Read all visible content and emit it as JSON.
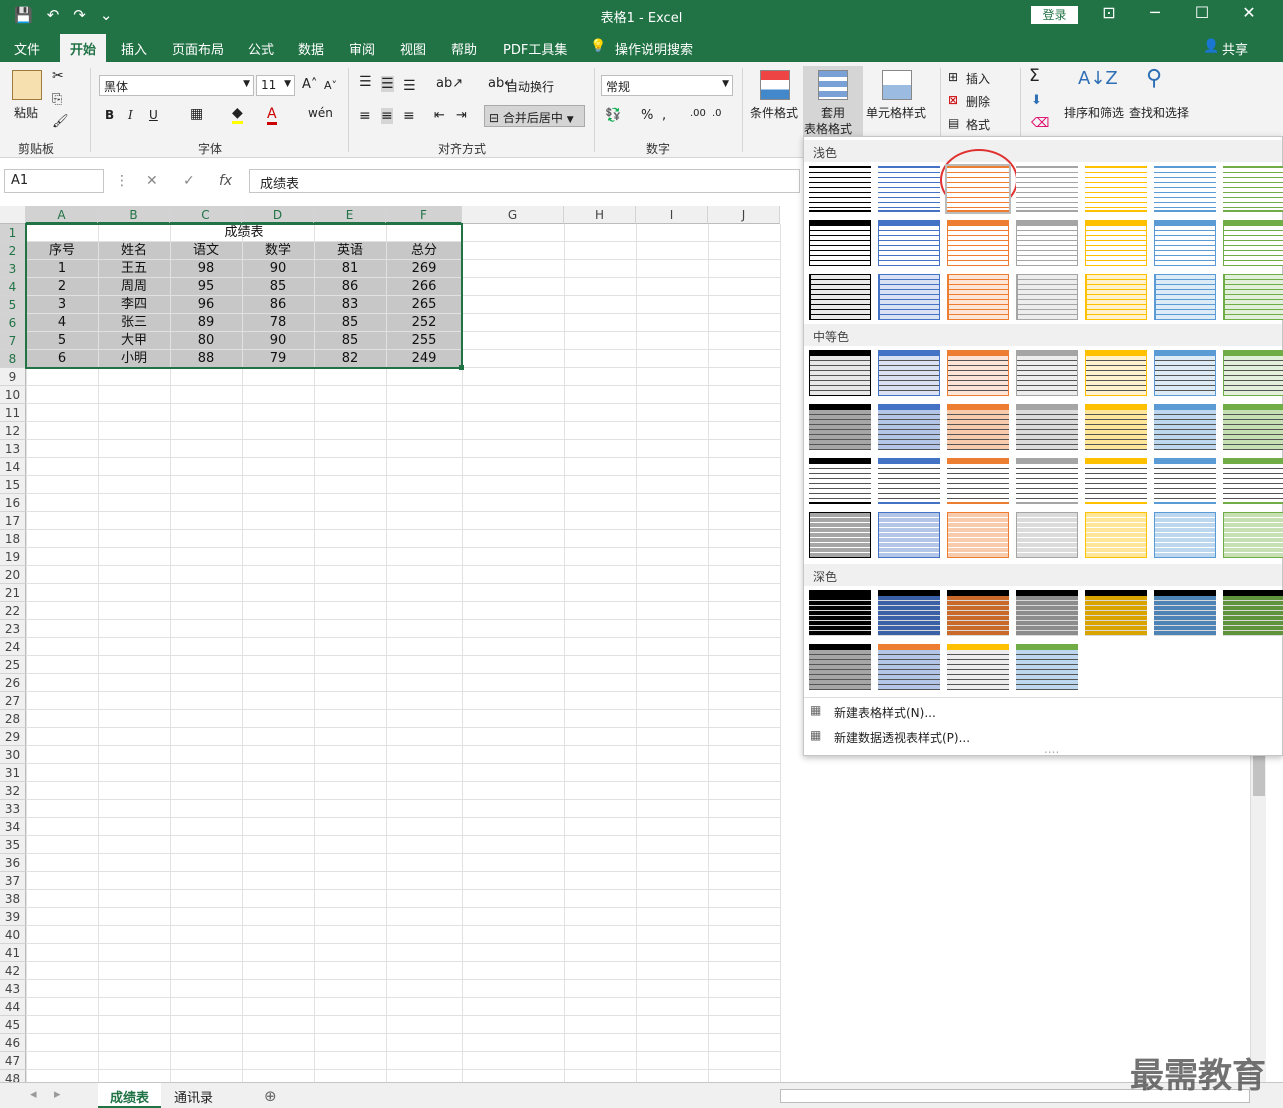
{
  "titlebar": {
    "title": "表格1 - Excel",
    "login": "登录",
    "qat": [
      "💾",
      "↶",
      "↷",
      "⌄"
    ],
    "wc": [
      "⊡",
      "─",
      "☐",
      "✕"
    ]
  },
  "menu": {
    "tabs": [
      "文件",
      "开始",
      "插入",
      "页面布局",
      "公式",
      "数据",
      "审阅",
      "视图",
      "帮助",
      "PDF工具集"
    ],
    "search": "操作说明搜索",
    "share": "共享"
  },
  "ribbon": {
    "clipboard": {
      "label": "剪贴板",
      "paste": "粘贴"
    },
    "font": {
      "label": "字体",
      "name": "黑体",
      "size": "11",
      "bold": "B",
      "italic": "I",
      "underline": "U"
    },
    "align": {
      "label": "对齐方式",
      "wrap": "自动换行",
      "merge": "合并后居中"
    },
    "number": {
      "label": "数字",
      "format": "常规"
    },
    "styles": {
      "cond": "条件格式",
      "table": "套用",
      "table2": "表格格式",
      "cell": "单元格样式"
    },
    "cells": {
      "insert": "插入",
      "delete": "删除",
      "format": "格式"
    },
    "edit": {
      "sort": "排序和筛选",
      "find": "查找和选择"
    }
  },
  "formula": {
    "name_box": "A1",
    "content": "成绩表"
  },
  "columns": [
    "A",
    "B",
    "C",
    "D",
    "E",
    "F",
    "G",
    "H",
    "I",
    "J"
  ],
  "table": {
    "title": "成绩表",
    "headers": [
      "序号",
      "姓名",
      "语文",
      "数学",
      "英语",
      "总分"
    ],
    "rows": [
      [
        "1",
        "王五",
        "98",
        "90",
        "81",
        "269"
      ],
      [
        "2",
        "周周",
        "95",
        "85",
        "86",
        "266"
      ],
      [
        "3",
        "李四",
        "96",
        "86",
        "83",
        "265"
      ],
      [
        "4",
        "张三",
        "89",
        "78",
        "85",
        "252"
      ],
      [
        "5",
        "大甲",
        "80",
        "90",
        "85",
        "255"
      ],
      [
        "6",
        "小明",
        "88",
        "79",
        "82",
        "249"
      ]
    ]
  },
  "gallery": {
    "sections": [
      "浅色",
      "中等色",
      "深色"
    ],
    "footer": [
      "新建表格样式(N)...",
      "新建数据透视表样式(P)..."
    ],
    "colors": [
      "#000000",
      "#4472c4",
      "#ed7d31",
      "#a5a5a5",
      "#ffc000",
      "#5b9bd5",
      "#70ad47"
    ],
    "highlighted": "浅色 row1 column3"
  },
  "sheets": [
    "成绩表",
    "通讯录"
  ],
  "watermark": "最需教育"
}
